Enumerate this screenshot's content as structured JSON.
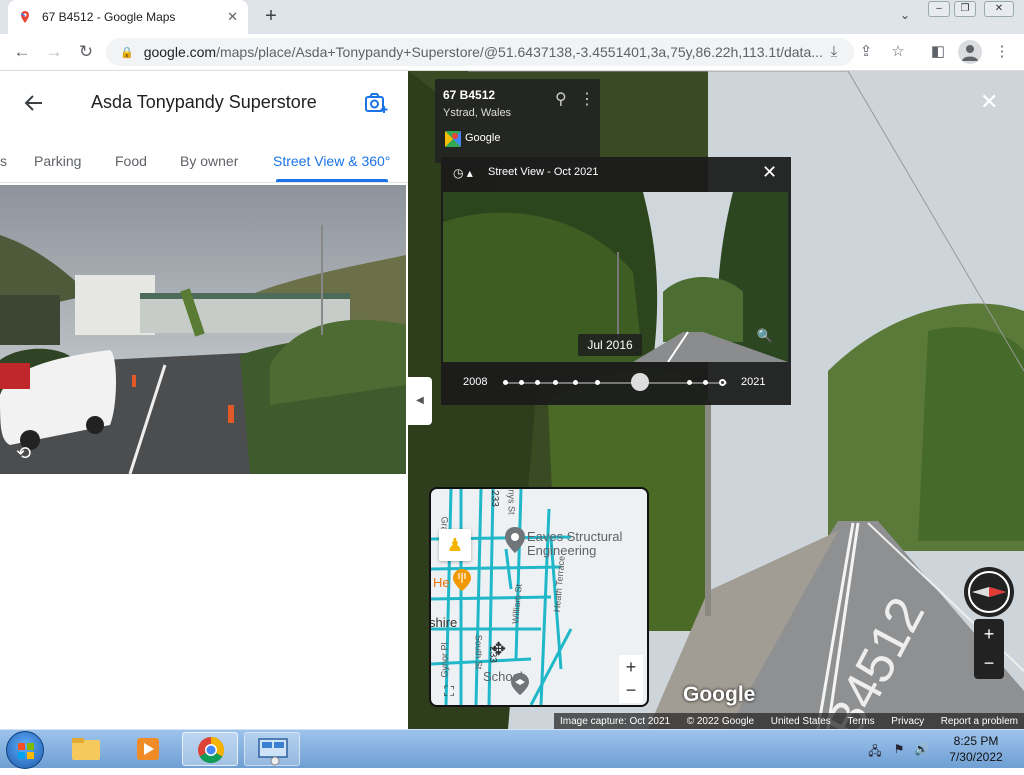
{
  "browser": {
    "tab_title": "67 B4512 - Google Maps",
    "tab_close": "✕",
    "new_tab": "+",
    "url_host": "google.com",
    "url_path": "/maps/place/Asda+Tonypandy+Superstore/@51.6437138,-3.4551401,3a,75y,86.22h,113.1t/data..."
  },
  "left_panel": {
    "title": "Asda Tonypandy Superstore",
    "tabs": [
      {
        "label": "s"
      },
      {
        "label": "Parking"
      },
      {
        "label": "Food"
      },
      {
        "label": "By owner"
      },
      {
        "label": "Street View & 360°"
      }
    ]
  },
  "street_view": {
    "road_name": "67 B4512",
    "place": "Ystrad, Wales",
    "provider": "Google",
    "time_machine": {
      "title": "Street View - Oct 2021",
      "current_date": "Jul 2016",
      "start_year": "2008",
      "end_year": "2021",
      "selected_fraction": 0.61
    },
    "minimap_labels": {
      "business": "Eaves Structural",
      "business2": "Engineering",
      "school": "School",
      "shire": "shire",
      "he": "He",
      "road_233a": "233",
      "road_233b": "233",
      "william": "William St",
      "heath": "Heath Terrace",
      "south": "South St",
      "gynor": "Gynor Pl",
      "nys": "nys St",
      "gra": "Gra"
    },
    "logo": "Google",
    "footer": {
      "capture": "Image capture: Oct 2021",
      "copyright": "© 2022 Google",
      "country": "United States",
      "terms": "Terms",
      "privacy": "Privacy",
      "report": "Report a problem"
    },
    "road_marking": "B4512"
  },
  "taskbar": {
    "time": "8:25 PM",
    "date": "7/30/2022"
  },
  "colors": {
    "accent": "#1a73e8",
    "map_road": "#20b7c9"
  }
}
